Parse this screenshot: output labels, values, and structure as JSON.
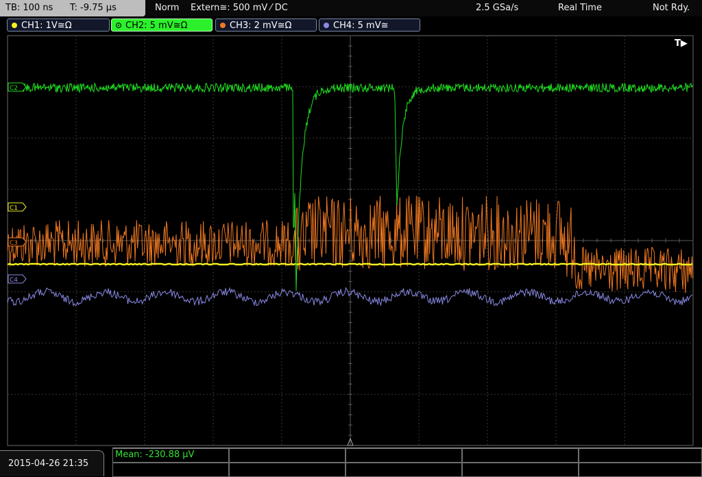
{
  "status": {
    "timebase": "TB: 100 ns",
    "trigger_time": "T: -9.75 µs",
    "trigger_mode": "Norm",
    "trigger_source": "Extern≅: 500 mV ⁄ DC",
    "sample_rate": "2.5 GSa/s",
    "acq_mode": "Real Time",
    "state": "Not Rdy."
  },
  "channels": [
    {
      "id": "ch1",
      "label": "CH1: 1V≅Ω",
      "color": "#f5f020",
      "marker": "C1"
    },
    {
      "id": "ch2",
      "label": "CH2: 5 mV≅Ω",
      "color": "#20e020",
      "marker": "C2",
      "active": true
    },
    {
      "id": "ch3",
      "label": "CH3: 2 mV≅Ω",
      "color": "#f07820",
      "marker": "C3"
    },
    {
      "id": "ch4",
      "label": "CH4: 5 mV≅",
      "color": "#8a8ae6",
      "marker": "C4"
    }
  ],
  "trigger_marker": "T▶",
  "datetime": "2015-04-26 21:35",
  "measurement": "Mean: -230.88 µV",
  "colors": {
    "grid": "#3a3a3a",
    "grid_center": "#5a5a5a",
    "ch1": "#f5f020",
    "ch2": "#20e020",
    "ch3": "#f07820",
    "ch4": "#8a8ae6"
  }
}
